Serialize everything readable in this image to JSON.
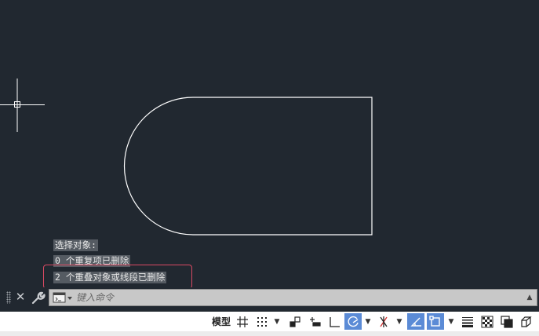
{
  "command_history": [
    "选择对象:",
    "0 个重复项已删除",
    "2 个重叠对象或线段已删除"
  ],
  "command_line": {
    "placeholder": "键入命令"
  },
  "statusbar": {
    "model_label": "模型",
    "buttons": [
      {
        "name": "grid-icon",
        "active": false
      },
      {
        "name": "snap-icon",
        "active": false
      },
      {
        "name": "infer-constraints-icon",
        "active": false
      },
      {
        "name": "dynamic-input-icon",
        "active": false
      },
      {
        "name": "ortho-icon",
        "active": false
      },
      {
        "name": "polar-tracking-icon",
        "active": true
      },
      {
        "name": "isodraft-icon",
        "active": false
      },
      {
        "name": "object-snap-tracking-icon",
        "active": true
      },
      {
        "name": "object-snap-icon",
        "active": true
      },
      {
        "name": "lineweight-icon",
        "active": false
      },
      {
        "name": "transparency-icon",
        "active": false
      },
      {
        "name": "selection-cycling-icon",
        "active": false
      },
      {
        "name": "3d-osnap-icon",
        "active": false
      }
    ]
  },
  "colors": {
    "canvas_bg": "#212830",
    "drawing_line": "#ffffff",
    "highlight_box": "#d94a63",
    "active_button": "#5b8bd6"
  }
}
